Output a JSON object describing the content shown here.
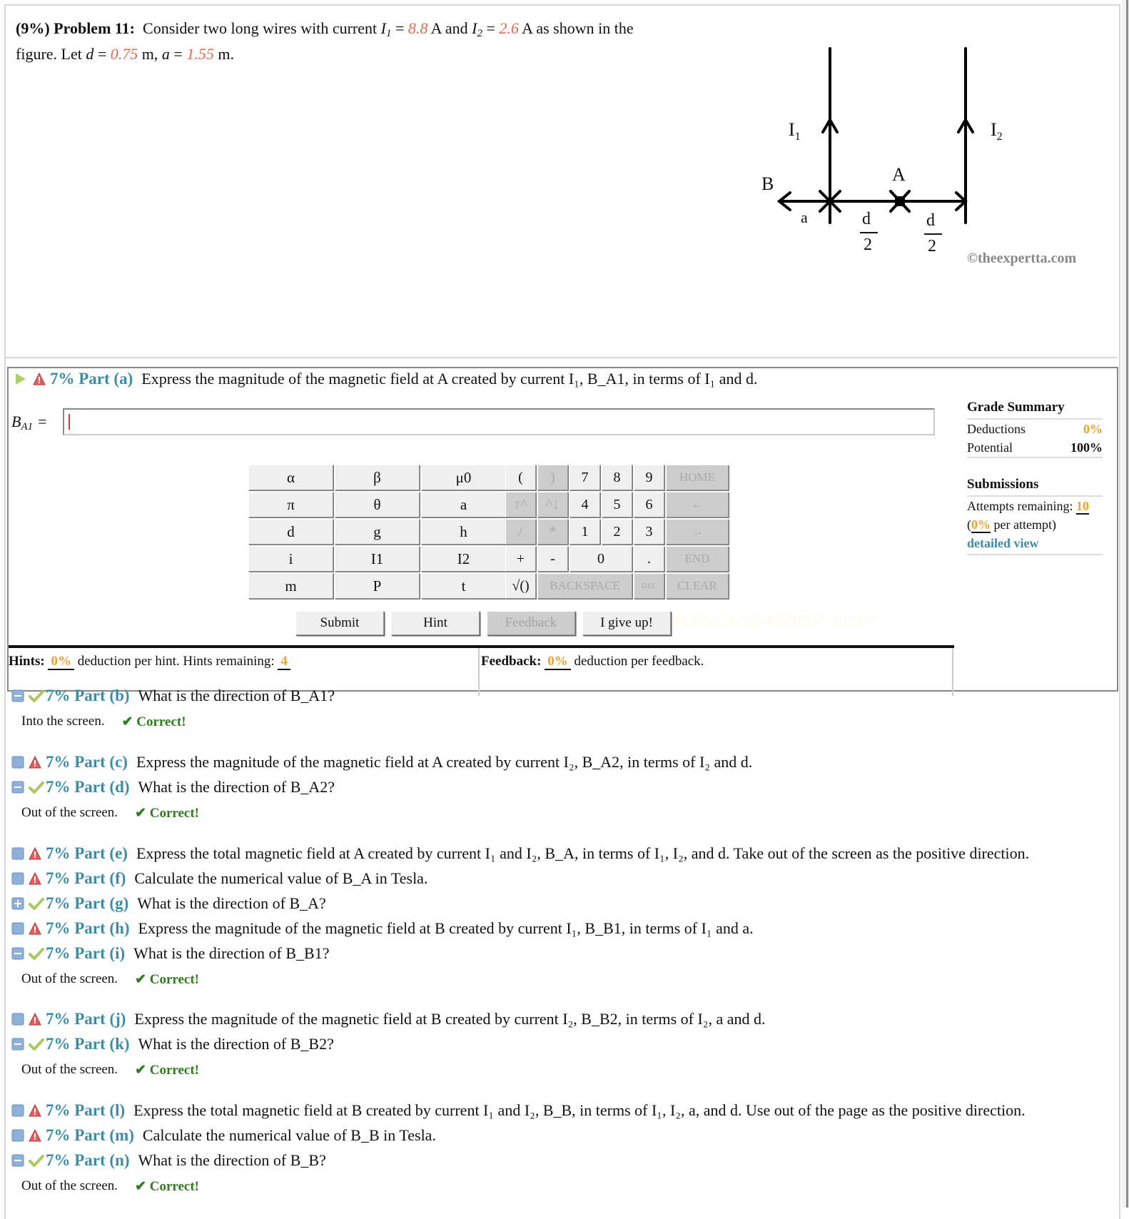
{
  "problem": {
    "weight": "(9%)",
    "title": "Problem 11:",
    "text_1": "Consider two long wires with current",
    "I1_symbol": "I",
    "I1_sub": "1",
    "I1_value": "8.8",
    "unit_A": "A and",
    "I2_symbol": "I",
    "I2_sub": "2",
    "I2_value": "2.6",
    "text_2": "A as shown in the",
    "text_3": "figure. Let",
    "d_symbol": "d",
    "d_value": "0.75",
    "a_symbol": "a",
    "a_value": "1.55",
    "unit_m": "m"
  },
  "figure": {
    "label_I1": "I",
    "label_I1_sub": "1",
    "label_I2": "I",
    "label_I2_sub": "2",
    "label_A": "A",
    "label_B": "B",
    "label_a": "a",
    "label_d": "d",
    "label_2": "2",
    "copyright": "©theexpertta.com"
  },
  "part_a": {
    "label": "7% Part (a)",
    "prompt": "Express the magnitude of the magnetic field at A created by current I₁, B_A1, in terms of I₁ and d.",
    "answer_label": "B",
    "answer_label_sub": "A1",
    "answer_value": ""
  },
  "keypad": {
    "left": [
      [
        "α",
        "β",
        "μ0"
      ],
      [
        "π",
        "θ",
        "a"
      ],
      [
        "d",
        "g",
        "h"
      ],
      [
        "i",
        "I1",
        "I2"
      ],
      [
        "m",
        "P",
        "t"
      ]
    ],
    "right_rows": [
      [
        "(",
        ")",
        "7",
        "8",
        "9",
        "HOME"
      ],
      [
        "↑^",
        "^↓",
        "4",
        "5",
        "6",
        "←"
      ],
      [
        "/",
        "*",
        "1",
        "2",
        "3",
        "→"
      ],
      [
        "+",
        "-",
        "0",
        ".",
        "END"
      ],
      [
        "√()",
        "BACKSPACE",
        "DEL",
        "CLEAR"
      ]
    ]
  },
  "buttons": {
    "submit": "Submit",
    "hint": "Hint",
    "feedback": "Feedback",
    "give_up": "I give up!"
  },
  "faint_code": "6C65-C4-2B-4B-9EDF-33197",
  "hints": {
    "label": "Hints:",
    "deduction": "0%",
    "text": "deduction per hint. Hints remaining:",
    "remaining": "4"
  },
  "feedback": {
    "label": "Feedback:",
    "deduction": "0%",
    "text": "deduction per feedback."
  },
  "grade_summary": {
    "title": "Grade Summary",
    "deductions_label": "Deductions",
    "deductions_value": "0%",
    "potential_label": "Potential",
    "potential_value": "100%"
  },
  "submissions": {
    "title": "Submissions",
    "attempts_label": "Attempts remaining:",
    "attempts_value": "10",
    "per_attempt_open": "(",
    "per_attempt_value": "0%",
    "per_attempt_text": "per attempt)",
    "detailed_view": "detailed view"
  },
  "parts": [
    {
      "id": "b",
      "label": "7% Part (b)",
      "status": "correct",
      "expand": "minus",
      "prompt": "What is the direction of B_A1?",
      "answer": "Into the screen.",
      "result": "✔ Correct!"
    },
    {
      "id": "c",
      "label": "7% Part (c)",
      "status": "warning",
      "expand": "minus",
      "prompt": "Express the magnitude of the magnetic field at A created by current I₂, B_A2, in terms of I₂ and d."
    },
    {
      "id": "d",
      "label": "7% Part (d)",
      "status": "correct",
      "expand": "minus",
      "prompt": "What is the direction of B_A2?",
      "answer": "Out of the screen.",
      "result": "✔ Correct!"
    },
    {
      "id": "e",
      "label": "7% Part (e)",
      "status": "warning",
      "expand": "minus",
      "prompt": "Express the total magnetic field at A created by current I₁ and I₂, B_A, in terms of I₁, I₂, and d. Take out of the screen as the positive direction."
    },
    {
      "id": "f",
      "label": "7% Part (f)",
      "status": "warning",
      "expand": "minus",
      "prompt": "Calculate the numerical value of B_A in Tesla."
    },
    {
      "id": "g",
      "label": "7% Part (g)",
      "status": "correct",
      "expand": "plus",
      "prompt": "What is the direction of B_A?"
    },
    {
      "id": "h",
      "label": "7% Part (h)",
      "status": "warning",
      "expand": "minus",
      "prompt": "Express the magnitude of the magnetic field at B created by current I₁, B_B1, in terms of I₁ and a."
    },
    {
      "id": "i",
      "label": "7% Part (i)",
      "status": "correct",
      "expand": "minus",
      "prompt": "What is the direction of B_B1?",
      "answer": "Out of the screen.",
      "result": "✔ Correct!"
    },
    {
      "id": "j",
      "label": "7% Part (j)",
      "status": "warning",
      "expand": "minus",
      "prompt": "Express the magnitude of the magnetic field at B created by current I₂, B_B2, in terms of I₂, a and d."
    },
    {
      "id": "k",
      "label": "7% Part (k)",
      "status": "correct",
      "expand": "minus",
      "prompt": "What is the direction of B_B2?",
      "answer": "Out of the screen.",
      "result": "✔ Correct!"
    },
    {
      "id": "l",
      "label": "7% Part (l)",
      "status": "warning",
      "expand": "minus",
      "prompt": "Express the total magnetic field at B created by current I₁ and I₂, B_B, in terms of I₁, I₂, a, and d. Use out of the page as the positive direction."
    },
    {
      "id": "m",
      "label": "7% Part (m)",
      "status": "warning",
      "expand": "minus",
      "prompt": "Calculate the numerical value of B_B in Tesla."
    },
    {
      "id": "n",
      "label": "7% Part (n)",
      "status": "correct",
      "expand": "minus",
      "prompt": "What is the direction of B_B?",
      "answer": "Out of the screen.",
      "result": "✔ Correct!"
    }
  ]
}
